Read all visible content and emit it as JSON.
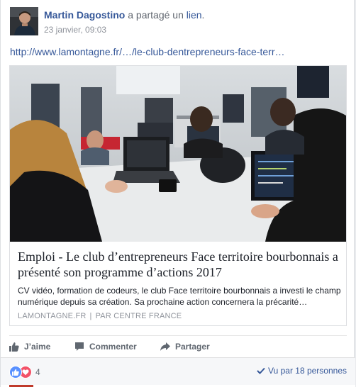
{
  "post": {
    "author": "Martin Dagostino",
    "verb": "a partagé un",
    "link_word": "lien",
    "period": ".",
    "timestamp": "23 janvier, 09:03",
    "url": "http://www.lamontagne.fr/…/le-club-dentrepreneurs-face-terr…"
  },
  "link_card": {
    "title": "Emploi - Le club d’entrepreneurs Face territoire bourbonnais a présenté son programme d’actions 2017",
    "description": "CV vidéo, formation de codeurs, le club Face territoire bourbonnais a investi le champ numérique depuis sa création. Sa prochaine action concernera la précarité…",
    "source": "LAMONTAGNE.FR",
    "separator": "|",
    "credit": "PAR CENTRE FRANCE"
  },
  "actions": {
    "like": "J’aime",
    "comment": "Commenter",
    "share": "Partager"
  },
  "stats": {
    "reaction_count": "4",
    "seen_by": "Vu par 18 personnes"
  },
  "colors": {
    "link_blue": "#365899",
    "like_blue": "#5890ff",
    "love_red": "#f25268",
    "meta_gray": "#90949c"
  }
}
